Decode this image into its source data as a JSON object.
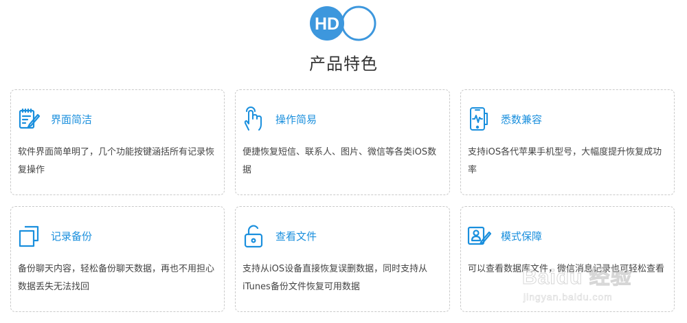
{
  "logo": {
    "text": "HD",
    "accent": "#3d97dd"
  },
  "section_title": "产品特色",
  "colors": {
    "accent": "#1a8fdd",
    "border": "#c9c9c9",
    "text": "#444444"
  },
  "features": [
    {
      "icon": "edit-document-icon",
      "title": "界面简洁",
      "desc": "软件界面简单明了，几个功能按键涵括所有记录恢复操作"
    },
    {
      "icon": "touch-hand-icon",
      "title": "操作简易",
      "desc": "便捷恢复短信、联系人、图片、微信等各类iOS数据"
    },
    {
      "icon": "phone-compatibility-icon",
      "title": "悉数兼容",
      "desc": "支持iOS各代苹果手机型号，大幅度提升恢复成功率"
    },
    {
      "icon": "copy-backup-icon",
      "title": "记录备份",
      "desc": "备份聊天内容，轻松备份聊天数据，再也不用担心数据丢失无法找回"
    },
    {
      "icon": "unlock-icon",
      "title": "查看文件",
      "desc": "支持从iOS设备直接恢复误删数据，同时支持从iTunes备份文件恢复可用数据"
    },
    {
      "icon": "user-edit-icon",
      "title": "模式保障",
      "desc": "可以查看数据库文件，微信消息记录也可轻松查看"
    }
  ],
  "watermark": {
    "brand": "Baidu 经验",
    "url": "jingyan.baidu.com"
  }
}
